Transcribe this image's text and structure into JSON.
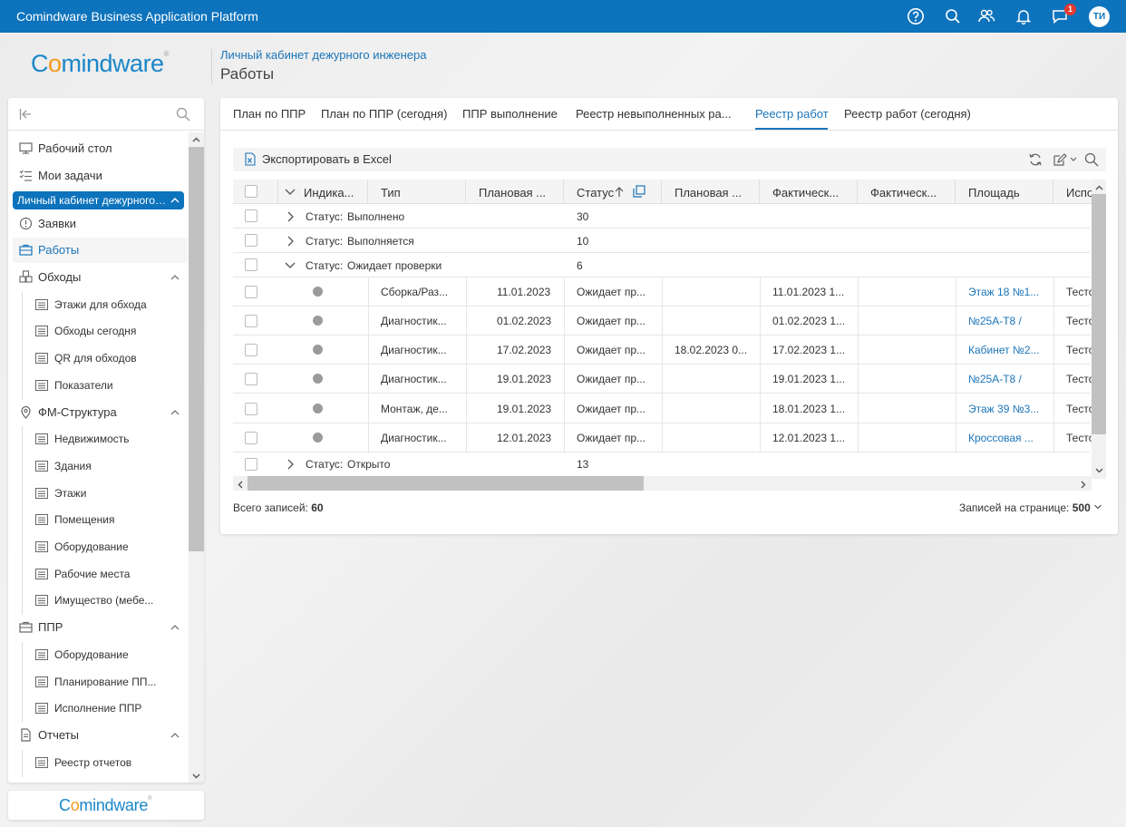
{
  "app": {
    "title": "Comindware Business Application Platform",
    "notifications_count": "1",
    "user_initials": "ТИ",
    "accent": "#0d73bd",
    "badge_color": "#e3392f"
  },
  "logo": {
    "part1": "C",
    "part2": "o",
    "part3": "mindware",
    "reg": "®"
  },
  "header": {
    "breadcrumb": "Личный кабинет дежурного инженера",
    "title": "Работы"
  },
  "sidebar": {
    "items": [
      {
        "label": "Рабочий стол",
        "icon": "desktop-icon"
      },
      {
        "label": "Мои задачи",
        "icon": "tasks-icon"
      }
    ],
    "section": "Личный кабинет дежурного инженера",
    "section_items": [
      {
        "label": "Заявки",
        "icon": "alert-circle-icon"
      },
      {
        "label": "Работы",
        "icon": "briefcase-icon"
      }
    ],
    "groups": [
      {
        "label": "Обходы",
        "icon": "cubes-icon",
        "items": [
          "Этажи для обхода",
          "Обходы сегодня",
          "QR для обходов",
          "Показатели"
        ]
      },
      {
        "label": "ФМ-Структура",
        "icon": "map-pin-icon",
        "items": [
          "Недвижимость",
          "Здания",
          "Этажи",
          "Помещения",
          "Оборудование",
          "Рабочие места",
          "Имущество (мебе..."
        ]
      },
      {
        "label": "ППР",
        "icon": "briefcase-icon",
        "items": [
          "Оборудование",
          "Планирование ПП...",
          "Исполнение ППР"
        ]
      },
      {
        "label": "Отчеты",
        "icon": "document-icon",
        "items": [
          "Реестр отчетов"
        ]
      }
    ]
  },
  "tabs": [
    "План по ППР",
    "План по ППР (сегодня)",
    "ППР выполнение",
    "Реестр невыполненных ра...",
    "Реестр работ",
    "Реестр работ (сегодня)"
  ],
  "active_tab": "Реестр работ",
  "toolbar": {
    "export_label": "Экспортировать в Excel"
  },
  "grid": {
    "columns": [
      "Индика...",
      "Тип",
      "Плановая ...",
      "Статус",
      "Плановая ...",
      "Фактическ...",
      "Фактическ...",
      "Площадь",
      "Испо"
    ],
    "group_prefix": "Статус:",
    "groups_top": [
      {
        "name": "Выполнено",
        "count": "30"
      },
      {
        "name": "Выполняется",
        "count": "10"
      },
      {
        "name": "Ожидает проверки",
        "count": "6"
      }
    ],
    "rows": [
      {
        "type": "Сборка/Раз...",
        "plan": "11.01.2023",
        "status": "Ожидает пр...",
        "plan2": "",
        "fact": "11.01.2023 1...",
        "fact2": "",
        "area": "Этаж 18 №1...",
        "exec": "Тесто"
      },
      {
        "type": "Диагностик...",
        "plan": "01.02.2023",
        "status": "Ожидает пр...",
        "plan2": "",
        "fact": "01.02.2023 1...",
        "fact2": "",
        "area": "№25А-Т8 /",
        "exec": "Тесто"
      },
      {
        "type": "Диагностик...",
        "plan": "17.02.2023",
        "status": "Ожидает пр...",
        "plan2": "18.02.2023 0...",
        "fact": "17.02.2023 1...",
        "fact2": "",
        "area": "Кабинет №2...",
        "exec": "Тесто"
      },
      {
        "type": "Диагностик...",
        "plan": "19.01.2023",
        "status": "Ожидает пр...",
        "plan2": "",
        "fact": "19.01.2023 1...",
        "fact2": "",
        "area": "№25А-Т8 /",
        "exec": "Тесто"
      },
      {
        "type": "Монтаж, де...",
        "plan": "19.01.2023",
        "status": "Ожидает пр...",
        "plan2": "",
        "fact": "18.01.2023 1...",
        "fact2": "",
        "area": "Этаж 39 №3...",
        "exec": "Тесто"
      },
      {
        "type": "Диагностик...",
        "plan": "12.01.2023",
        "status": "Ожидает пр...",
        "plan2": "",
        "fact": "12.01.2023 1...",
        "fact2": "",
        "area": "Кроссовая ...",
        "exec": "Тесто"
      }
    ],
    "group_bottom": {
      "name": "Открыто",
      "count": "13"
    }
  },
  "footer": {
    "total_label": "Всего записей:",
    "total_value": "60",
    "page_size_label": "Записей на странице:",
    "page_size_value": "500"
  }
}
